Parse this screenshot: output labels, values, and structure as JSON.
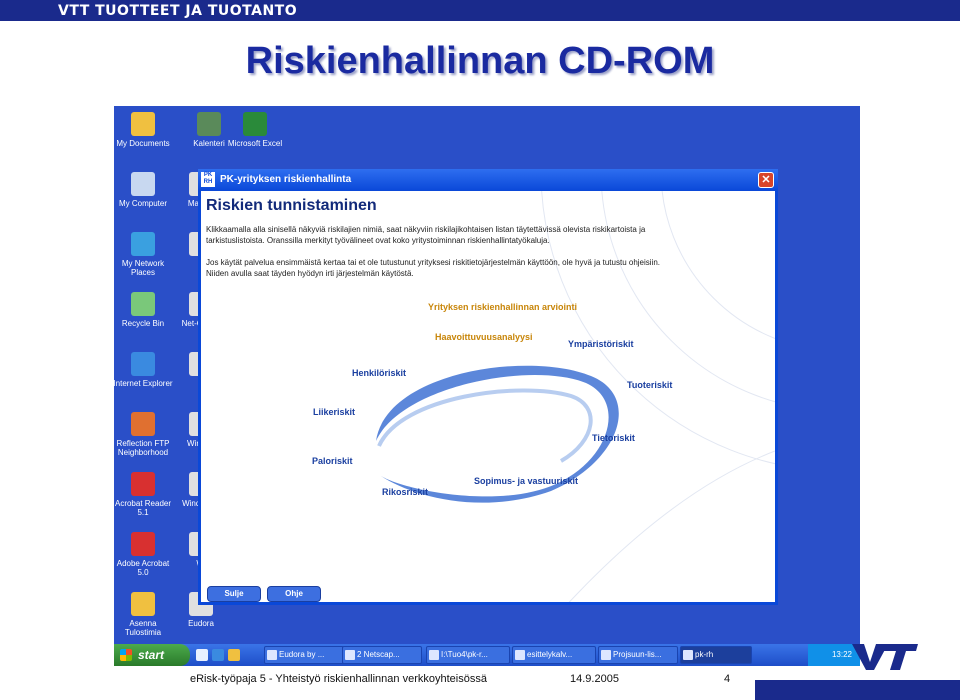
{
  "header": {
    "brand": "VTT TUOTTEET JA TUOTANTO"
  },
  "slide": {
    "title": "Riskienhallinnan CD-ROM"
  },
  "desktop_icons": [
    {
      "label": "My Documents",
      "color": "#f0c040"
    },
    {
      "label": "Kalenteri",
      "color": "#5a8a5a"
    },
    {
      "label": "Microsoft Excel",
      "color": "#2a8a3a"
    },
    {
      "label": "My Computer",
      "color": "#c8d8f0"
    },
    {
      "label": "Mat-tall",
      "color": "#e0e0e0"
    },
    {
      "label": "My Network Places",
      "color": "#3aa0e0"
    },
    {
      "label": "M",
      "color": "#e0e0e0"
    },
    {
      "label": "Recycle Bin",
      "color": "#7ac87a"
    },
    {
      "label": "Net-Comm",
      "color": "#e0e0e0"
    },
    {
      "label": "Internet Explorer",
      "color": "#3a8ae0"
    },
    {
      "label": "T",
      "color": "#e0e0e0"
    },
    {
      "label": "Reflection FTP Neighborhood",
      "color": "#e07030"
    },
    {
      "label": "Wir Exp",
      "color": "#e0e0e0"
    },
    {
      "label": "Acrobat Reader 5.1",
      "color": "#d83030"
    },
    {
      "label": "Window Pl",
      "color": "#e0e0e0"
    },
    {
      "label": "Adobe Acrobat 5.0",
      "color": "#d83030"
    },
    {
      "label": "Wi",
      "color": "#e0e0e0"
    },
    {
      "label": "Asenna Tulostimia",
      "color": "#f0c040"
    },
    {
      "label": "Eudora",
      "color": "#e0e0e0"
    }
  ],
  "window": {
    "logo": "PK RH",
    "title": "PK-yrityksen riskienhallinta",
    "close": "✕",
    "heading": "Riskien tunnistaminen",
    "paragraph1": "Klikkaamalla alla sinisellä näkyviä riskilajien nimiä, saat näkyviin riskilajikohtaisen listan täytettävissä olevista riskikartoista ja tarkistuslistoista. Oranssilla merkityt työvälineet ovat koko yritystoiminnan riskienhallintatyökaluja.",
    "paragraph2": "Jos käytät palvelua ensimmäistä kertaa tai et ole tutustunut yrityksesi riskitietojärjestelmän käyttöön, ole hyvä ja tutustu ohjeisiin. Niiden avulla saat täyden hyödyn irti järjestelmän käytöstä.",
    "tools": {
      "assessment": "Yrityksen riskienhallinnan arviointi",
      "vulnerability": "Haavoittuvuusanalyysi"
    },
    "risks": {
      "environment": "Ympäristöriskit",
      "personnel": "Henkilöriskit",
      "product": "Tuoteriskit",
      "business": "Liikeriskit",
      "information": "Tietoriskit",
      "fire": "Paloriskit",
      "contract": "Sopimus- ja vastuuriskit",
      "crime": "Rikosriskit"
    },
    "buttons": {
      "close": "Sulje",
      "help": "Ohje"
    }
  },
  "taskbar": {
    "start": "start",
    "items": [
      "Eudora by ...",
      "2 Netscap...",
      "I:\\Tuo4\\pk-r...",
      "esittelykalv...",
      "Projsuun-lis...",
      "pk-rh"
    ],
    "clock": "13:22"
  },
  "footer": {
    "text": "eRisk-työpaja 5 - Yhteistyö riskienhallinnan verkkoyhteisössä",
    "date": "14.9.2005",
    "page": "4"
  },
  "colors": {
    "brand": "#1a2a8c",
    "desktop": "#2a4fc8",
    "tool_label": "#c8860a",
    "risk_label": "#1a3fa0"
  }
}
